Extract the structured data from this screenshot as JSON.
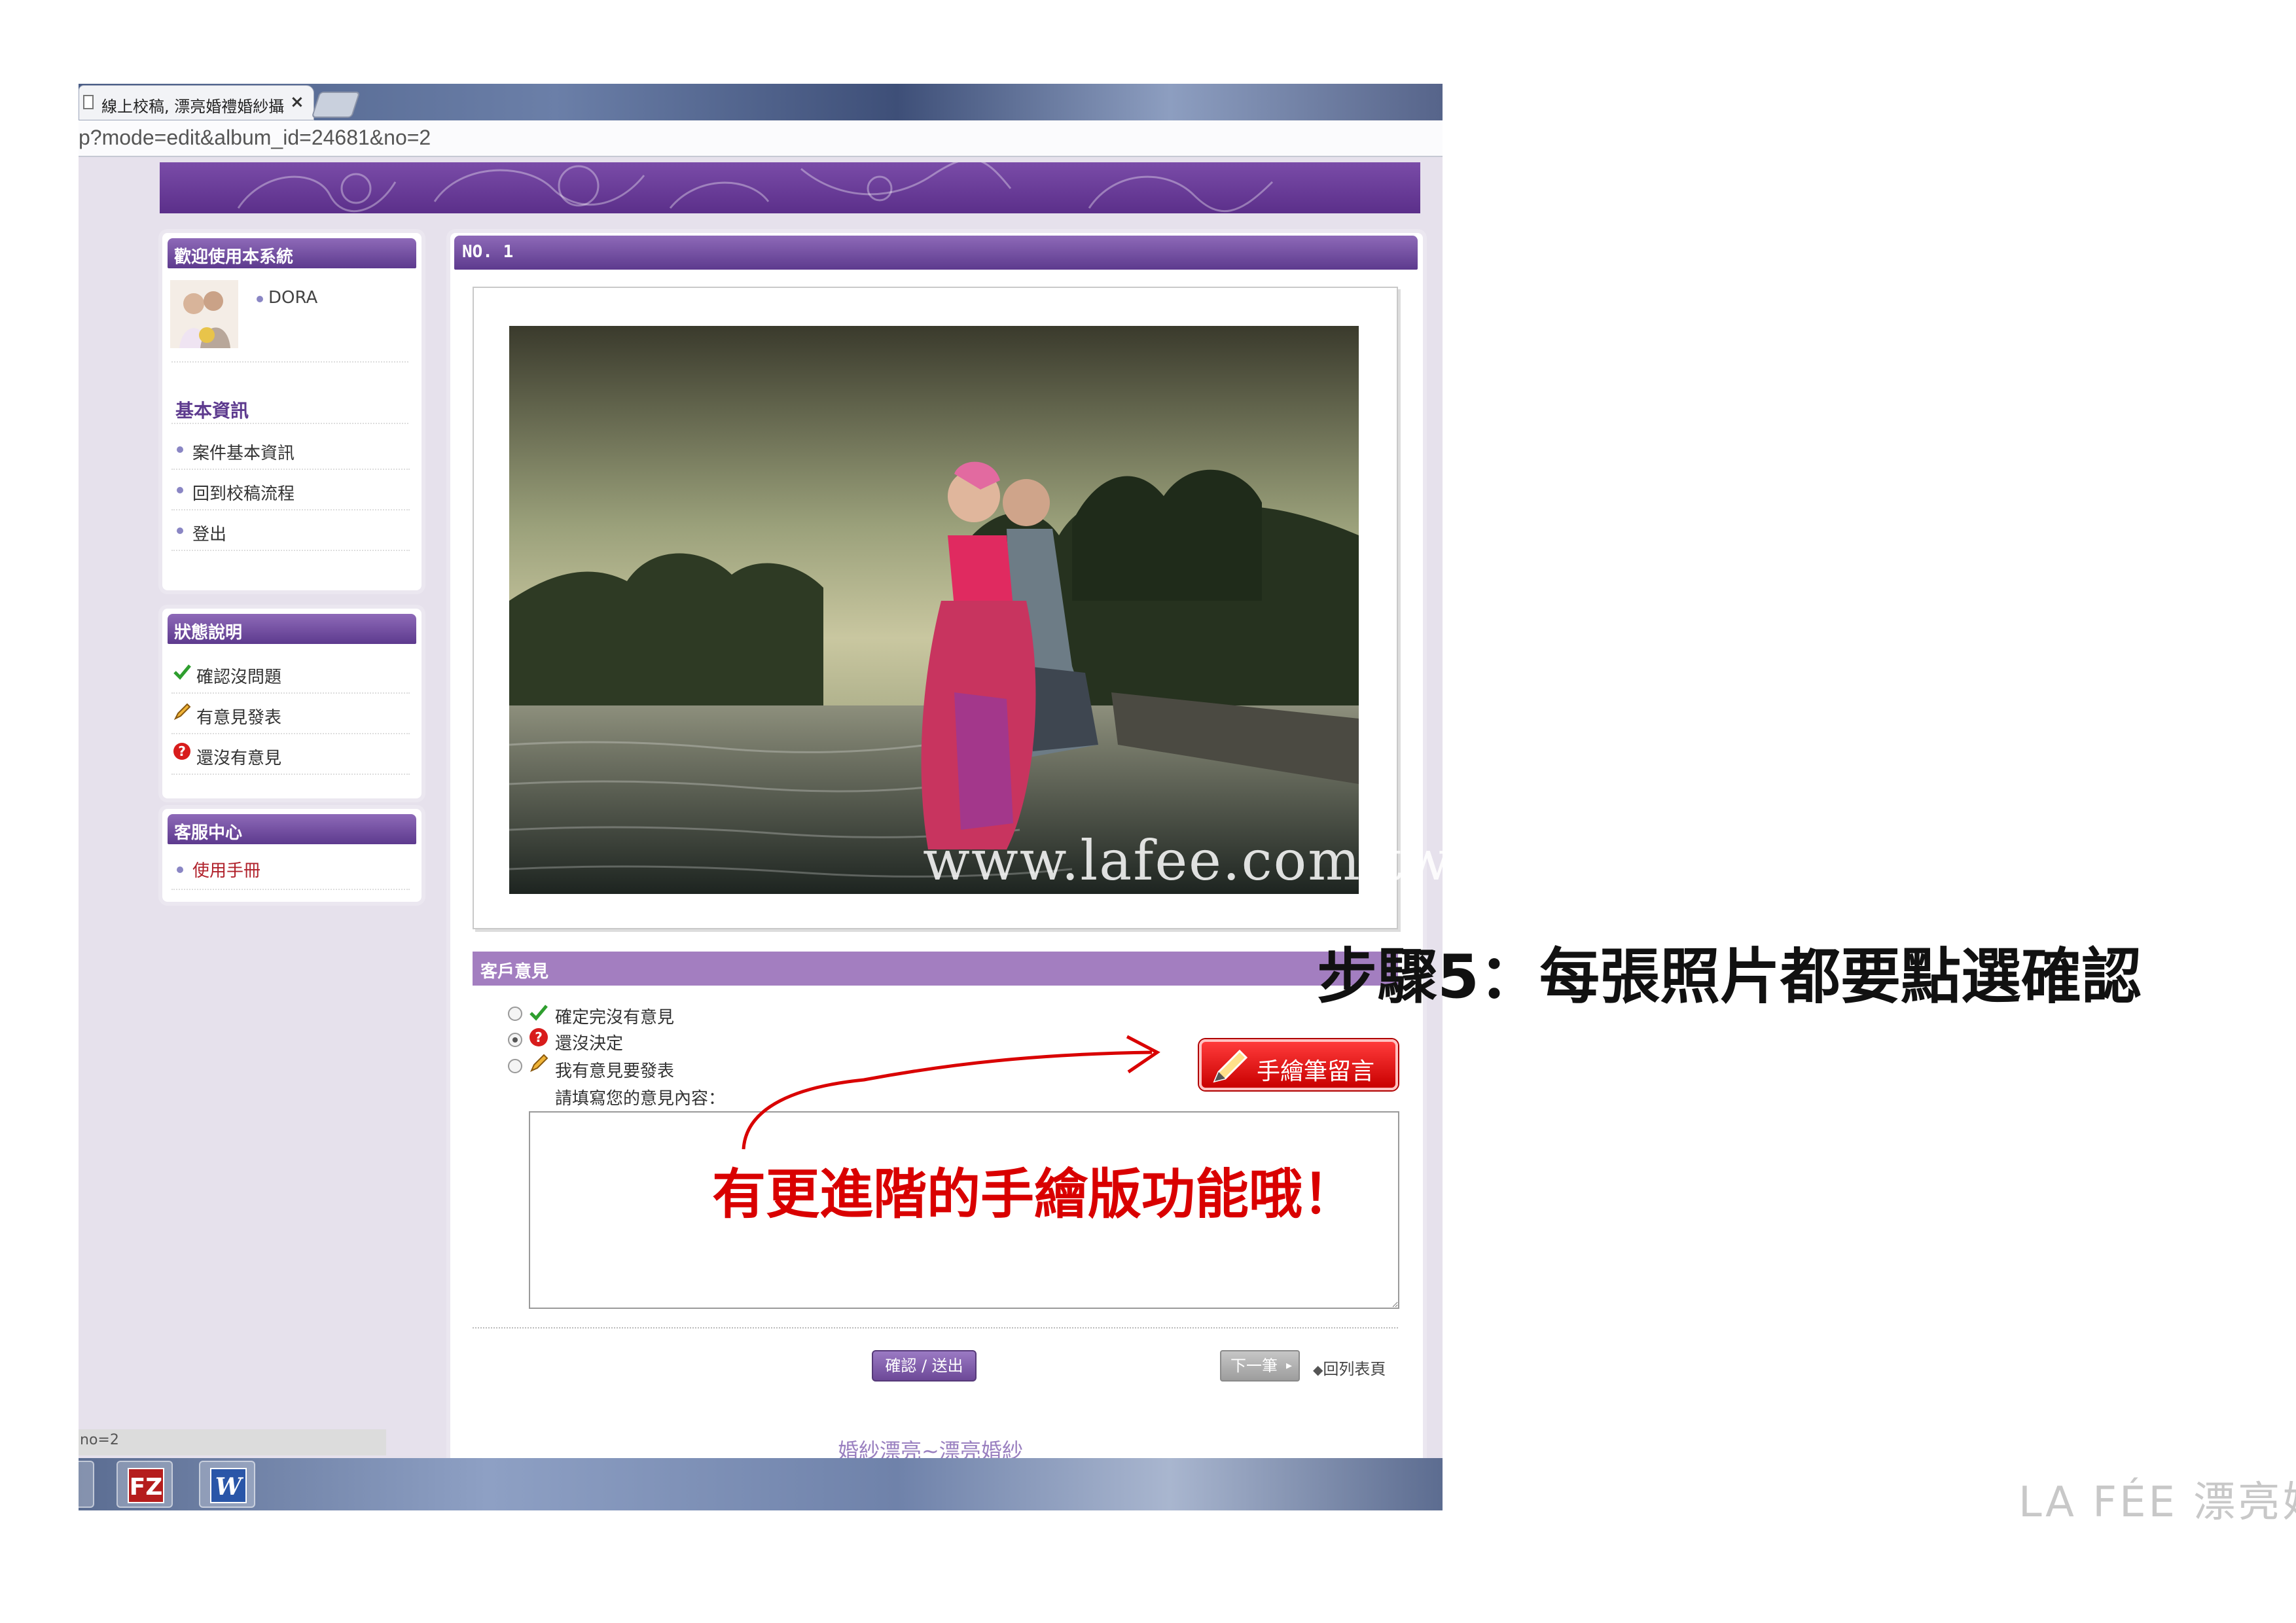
{
  "browser": {
    "tab_title": "線上校稿, 漂亮婚禮婚紗攝",
    "tab_close": "×",
    "address": "p?mode=edit&album_id=24681&no=2",
    "status_url": "no=2"
  },
  "sidebar": {
    "welcome": {
      "header": "歡迎使用本系統",
      "user": "DORA"
    },
    "basic_info": {
      "title": "基本資訊",
      "items": [
        "案件基本資訊",
        "回到校稿流程",
        "登出"
      ]
    },
    "status_legend": {
      "header": "狀態說明",
      "items": [
        "確認沒問題",
        "有意見發表",
        "還沒有意見"
      ]
    },
    "service": {
      "header": "客服中心",
      "items": [
        "使用手冊"
      ]
    }
  },
  "main": {
    "photo_number": "NO. 1",
    "watermark": "www.lafee.com.tw",
    "opinion": {
      "header": "客戶意見",
      "options": [
        "確定完沒有意見",
        "還沒決定",
        "我有意見要發表"
      ],
      "selected_index": 1,
      "prompt": "請填寫您的意見內容：",
      "textarea_value": ""
    },
    "draw_button_label": "手繪筆留言",
    "confirm_button_label": "確認 / 送出",
    "next_button_label": "下一筆",
    "back_link_label": "回列表頁",
    "footer": "婚紗漂亮~漂亮婚紗"
  },
  "annotation": {
    "step_text": "步驟5：每張照片都要點選確認",
    "callout_text": "有更進階的手繪版功能哦！",
    "color": "#d90000"
  },
  "brand": {
    "logo_text": "LA FÉE 漂亮婚紗"
  },
  "colors": {
    "purple_header": "#5d3a8e",
    "draw_button": "#e10000"
  }
}
